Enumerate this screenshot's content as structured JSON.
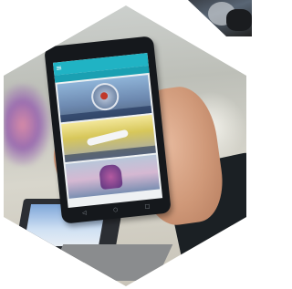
{
  "image": {
    "shape": "hexagon",
    "subject": "hand-holding-smartphone"
  },
  "phone": {
    "appbar": {
      "menu_icon": "hamburger-icon",
      "title": "",
      "accent_color": "#20b3c4"
    },
    "cards": [
      {
        "caption": ""
      },
      {
        "caption": ""
      },
      {
        "caption": ""
      }
    ],
    "navbar": {
      "back_icon": "back-icon",
      "home_icon": "home-icon",
      "recents_icon": "recents-icon"
    }
  }
}
